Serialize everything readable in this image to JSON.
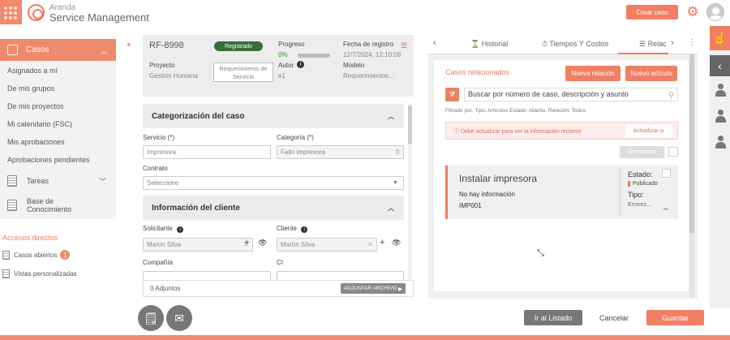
{
  "app": {
    "brand_top": "Aranda",
    "brand_bottom": "Service Management",
    "create_case": "Crear caso"
  },
  "sidebar": {
    "casos": "Casos",
    "items": [
      "Asignados a mí",
      "De mis grupos",
      "De mis proyectos",
      "Mi calendario (FSC)",
      "Mis aprobaciones",
      "Aprobaciones pendientes"
    ],
    "tareas": "Tareas",
    "base_line1": "Base de",
    "base_line2": "Conocimiento",
    "accesos": "Accesos directos",
    "casos_abiertos": "Casos abiertos",
    "casos_abiertos_count": "1",
    "vistas": "Vistas personalizadas"
  },
  "header": {
    "id": "RF-8998",
    "estado": "Registrado",
    "progreso_label": "Progreso",
    "progreso_value": "0%",
    "progreso_fraction": 0,
    "fecha_label": "Fecha de registro",
    "fecha_value": "12/7/2024, 12:10:09",
    "proyecto_label": "Proyecto",
    "proyecto_value": "Gestión Humana",
    "tipo_line1": "Requerimiento de",
    "tipo_line2": "Servicio",
    "autor_label": "Autor",
    "autor_value": "e1",
    "modelo_label": "Modelo",
    "modelo_value": "Requerimientos..."
  },
  "form": {
    "cat_section": "Categorización del caso",
    "servicio_label": "Servicio (*)",
    "servicio_value": "Impresora",
    "categoria_label": "Categoría (*)",
    "categoria_placeholder": "Fallo impresora",
    "contrato_label": "Contrato",
    "contrato_value": "Seleccione",
    "cliente_section": "Información del cliente",
    "solicitante_label": "Solicitante",
    "solicitante_value": "Martín Silva",
    "cliente_label": "Cliente",
    "cliente_value": "Martín Silva",
    "compania_label": "Compañía",
    "ci_label": "CI",
    "adjuntos": "0 Adjuntos",
    "adjuntar": "ADJUNTAR ARCHIVO"
  },
  "right": {
    "tabs": [
      "Historial",
      "Tiempos Y Costos",
      "Relac"
    ],
    "title": "Casos relacionados",
    "nueva_relacion": "Nueva relación",
    "nuevo_articulo": "Nuevo artículo",
    "search_value": "Buscar por número de caso, descripción y asunto",
    "filtrado_prefix": "Filtrado por:",
    "filtrado_text": "Tipo: Artículos Estado: Abierto, Relación: Todos",
    "alert": "Debe actualizar para ver la información reciente",
    "actualizar": "Actualizar",
    "desasociar": "Desasociar",
    "card": {
      "title": "Instalar impresora",
      "info": "No hay información",
      "code": "IMP001",
      "estado_label": "Estado:",
      "estado_value": "Publicado",
      "tipo_label": "Tipo:",
      "tipo_value": "Errores..."
    }
  },
  "footer": {
    "listado": "Ir al Listado",
    "cancelar": "Cancelar",
    "guardar": "Guardar"
  },
  "colors": {
    "accent": "#f07f63",
    "status_green": "#3a6e38"
  }
}
